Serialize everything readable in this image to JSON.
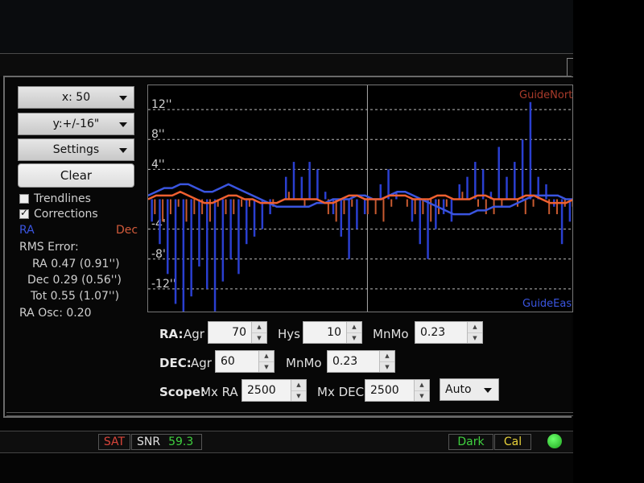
{
  "controls": {
    "x_scale": "x: 50",
    "y_scale": "y:+/-16\"",
    "settings": "Settings",
    "clear": "Clear",
    "trendlines": "Trendlines",
    "corrections": "Corrections",
    "corrections_checked": true,
    "trendlines_checked": false
  },
  "legend": {
    "ra": "RA",
    "dec": "Dec"
  },
  "rms": {
    "title": "RMS Error:",
    "ra": "RA 0.47 (0.91'')",
    "dec": "Dec 0.29 (0.56'')",
    "tot": "Tot 0.55 (1.07'')",
    "ra_osc": "RA Osc: 0.20"
  },
  "graph": {
    "y_ticks": [
      "12''",
      "8''",
      "4''",
      "-4''",
      "-8''",
      "-12''"
    ],
    "label_north": "GuideNorth",
    "label_east": "GuideEast"
  },
  "chart_data": {
    "type": "line",
    "ylim": [
      -16,
      16
    ],
    "series": [
      {
        "name": "RA",
        "color": "#3a55e0",
        "values": [
          0.5,
          1,
          1.5,
          1.5,
          2,
          2,
          1.5,
          1,
          1,
          1.5,
          2,
          1.5,
          1,
          0.5,
          0,
          -0.5,
          -1,
          -1,
          -1,
          -1,
          -1,
          -0.5,
          -0.5,
          0,
          0,
          0,
          0.5,
          0.5,
          0,
          0,
          0.5,
          1,
          1,
          0.5,
          0,
          -0.5,
          -1,
          -1.5,
          -2,
          -2,
          -2,
          -1.5,
          -1.5,
          -1,
          -1,
          -1,
          -0.5,
          0,
          0.5,
          0.5,
          0.5,
          0.5,
          0,
          0
        ]
      },
      {
        "name": "Dec",
        "color": "#f06030",
        "values": [
          0,
          0.5,
          0.5,
          0.5,
          1,
          0.5,
          0,
          -0.5,
          -0.5,
          0,
          0.5,
          0.5,
          0,
          0,
          -0.5,
          -0.5,
          -0.5,
          0,
          0,
          0,
          0,
          0,
          -0.5,
          -0.5,
          0,
          0.5,
          0.5,
          0,
          0,
          0,
          0.5,
          0.5,
          0.5,
          0,
          0,
          0,
          0.5,
          0.5,
          0,
          0,
          0,
          0.5,
          0.5,
          0,
          0,
          0,
          0,
          0.5,
          0.5,
          0,
          -0.5,
          -0.5,
          -0.5,
          0
        ]
      }
    ],
    "ra_corrections": [
      -3,
      -6,
      -10,
      -14,
      -16,
      -13,
      -9,
      -12,
      -15,
      -11,
      -8,
      -10,
      -6,
      -5,
      -4,
      -2,
      0,
      3,
      5,
      3,
      5,
      4,
      1,
      -2,
      -5,
      -8,
      -4,
      -2,
      0,
      2,
      4,
      1,
      0,
      -3,
      -6,
      -8,
      -4,
      -2,
      -3,
      2,
      3,
      5,
      4,
      1,
      7,
      3,
      5,
      8,
      13,
      3,
      2,
      -1,
      -6,
      -3
    ],
    "dec_corrections": [
      -2,
      -3,
      -2,
      -1,
      -3,
      -2,
      -2,
      -3,
      -1,
      -2,
      -2,
      -1,
      -1,
      0,
      0,
      -1,
      0,
      1,
      0,
      -1,
      0,
      0,
      -2,
      -3,
      -2,
      -1,
      0,
      -2,
      -2,
      -3,
      -1,
      0,
      -1,
      -2,
      -2,
      -3,
      -2,
      -1,
      0,
      1,
      0,
      -1,
      -2,
      -2,
      -1,
      0,
      -1,
      -2,
      -1,
      0,
      -2,
      -2,
      -1,
      -1
    ]
  },
  "ra_settings": {
    "label": "RA:",
    "agr_label": "Agr",
    "agr": "70",
    "hys_label": "Hys",
    "hys": "10",
    "mnmo_label": "MnMo",
    "mnmo": "0.23"
  },
  "dec_settings": {
    "label": "DEC:",
    "agr_label": "Agr",
    "agr": "60",
    "mnmo_label": "MnMo",
    "mnmo": "0.23"
  },
  "scope": {
    "label": "Scope:",
    "mxra_label": "Mx RA",
    "mxra": "2500",
    "mxdec_label": "Mx DEC",
    "mxdec": "2500",
    "mode": "Auto"
  },
  "status": {
    "sat": "SAT",
    "snr_label": "SNR",
    "snr": "59.3",
    "dark": "Dark",
    "cal": "Cal"
  }
}
